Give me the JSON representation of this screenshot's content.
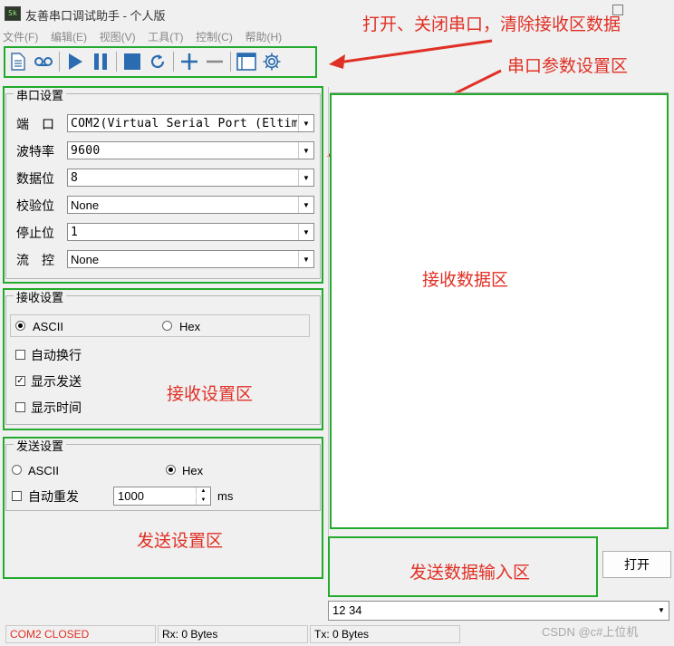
{
  "window": {
    "title": "友善串口调试助手 - 个人版",
    "icon_label": "Sk"
  },
  "menu": [
    "文件(F)",
    "编辑(E)",
    "视图(V)",
    "工具(T)",
    "控制(C)",
    "帮助(H)"
  ],
  "toolbar": {
    "icons": [
      "new-document-icon",
      "loop-icon",
      "play-icon",
      "pause-icon",
      "stop-icon",
      "refresh-icon",
      "add-icon",
      "remove-icon",
      "window-icon",
      "settings-gear-icon"
    ]
  },
  "annotations": {
    "toolbar_note": "打开、关闭串口，清除接收区数据",
    "serial_params_note": "串口参数设置区",
    "receive_data_area": "接收数据区",
    "receive_settings_area": "接收设置区",
    "send_settings_area": "发送设置区",
    "send_input_area": "发送数据输入区",
    "color": "#e03025",
    "box_color": "#22aa2c"
  },
  "serial_settings": {
    "title": "串口设置",
    "rows": [
      {
        "label": "端　口",
        "value": "COM2(Virtual Serial Port (Eltima"
      },
      {
        "label": "波特率",
        "value": "9600"
      },
      {
        "label": "数据位",
        "value": "8"
      },
      {
        "label": "校验位",
        "value": "None"
      },
      {
        "label": "停止位",
        "value": "1"
      },
      {
        "label": "流　控",
        "value": "None"
      }
    ]
  },
  "receive_settings": {
    "title": "接收设置",
    "ascii_label": "ASCII",
    "hex_label": "Hex",
    "selected_format": "ASCII",
    "auto_newline": {
      "label": "自动换行",
      "checked": false
    },
    "show_send": {
      "label": "显示发送",
      "checked": true
    },
    "show_time": {
      "label": "显示时间",
      "checked": false
    }
  },
  "send_settings": {
    "title": "发送设置",
    "ascii_label": "ASCII",
    "hex_label": "Hex",
    "selected_format": "Hex",
    "auto_resend": {
      "label": "自动重发",
      "checked": false
    },
    "interval_value": "1000",
    "interval_unit": "ms"
  },
  "open_button": "打开",
  "send_input_value": "12 34",
  "status": {
    "port": "COM2 CLOSED",
    "rx": "Rx: 0 Bytes",
    "tx": "Tx: 0 Bytes",
    "watermark": "CSDN @c#上位机"
  }
}
